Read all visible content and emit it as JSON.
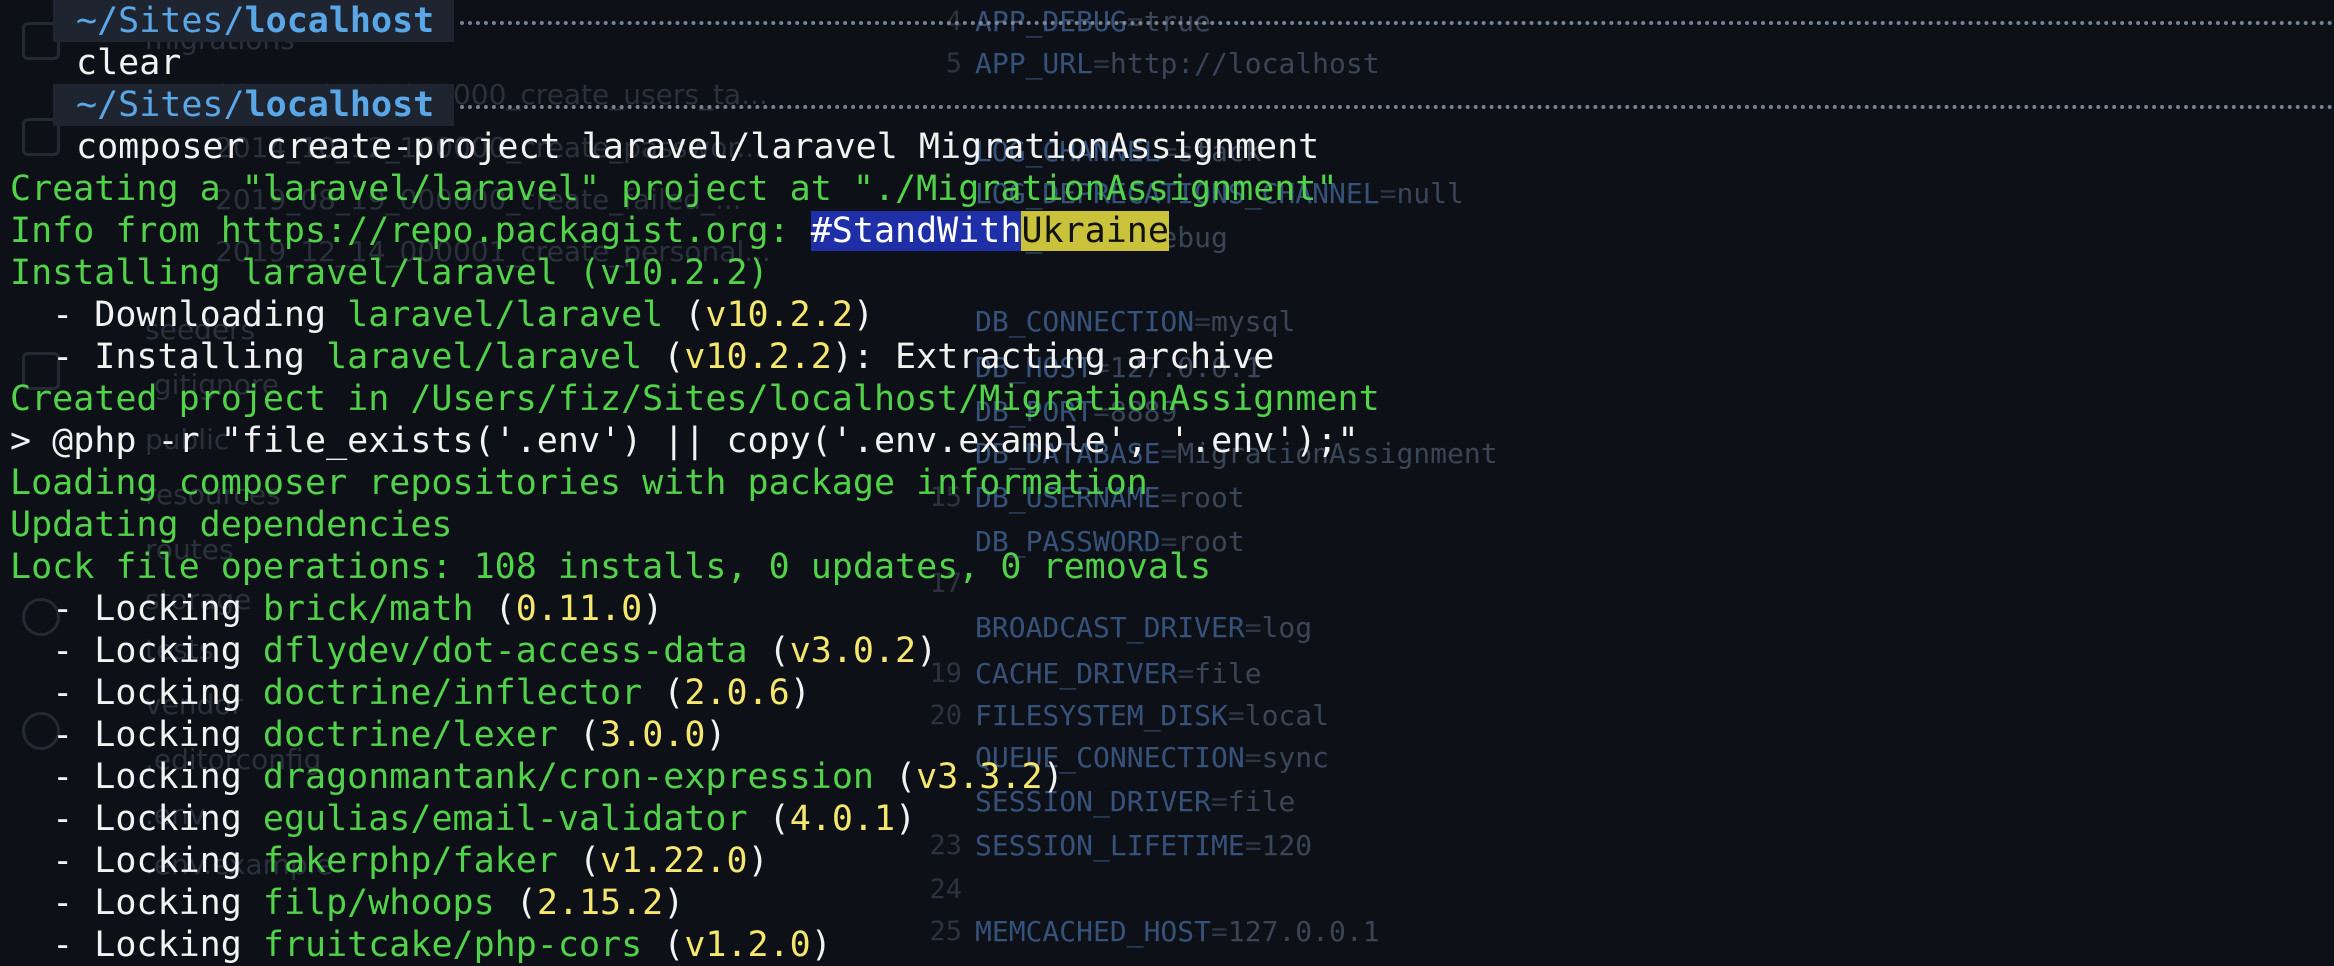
{
  "editor": {
    "lines": [
      {
        "n": "4",
        "key": "APP_DEBUG",
        "value": "true"
      },
      {
        "n": "5",
        "key": "APP_URL",
        "value": "http://localhost"
      },
      {
        "n": "",
        "key": "LOG_CHANNEL",
        "value": "stack"
      },
      {
        "n": "",
        "key": "LOG_DEPRECATIONS_CHANNEL",
        "value": "null"
      },
      {
        "n": "",
        "key": "LOG_LEVEL",
        "value": "debug"
      },
      {
        "n": "",
        "key": "DB_CONNECTION",
        "value": "mysql"
      },
      {
        "n": "",
        "key": "DB_HOST",
        "value": "127.0.0.1"
      },
      {
        "n": "",
        "key": "DB_PORT",
        "value": "8889"
      },
      {
        "n": "",
        "key": "DB_DATABASE",
        "value": "MigrationAssignment"
      },
      {
        "n": "15",
        "key": "DB_USERNAME",
        "value": "root"
      },
      {
        "n": "",
        "key": "DB_PASSWORD",
        "value": "root"
      },
      {
        "n": "17",
        "key": "",
        "value": ""
      },
      {
        "n": "",
        "key": "BROADCAST_DRIVER",
        "value": "log"
      },
      {
        "n": "19",
        "key": "CACHE_DRIVER",
        "value": "file"
      },
      {
        "n": "20",
        "key": "FILESYSTEM_DISK",
        "value": "local"
      },
      {
        "n": "",
        "key": "QUEUE_CONNECTION",
        "value": "sync"
      },
      {
        "n": "",
        "key": "SESSION_DRIVER",
        "value": "file"
      },
      {
        "n": "23",
        "key": "SESSION_LIFETIME",
        "value": "120"
      },
      {
        "n": "24",
        "key": "",
        "value": ""
      },
      {
        "n": "25",
        "key": "MEMCACHED_HOST",
        "value": "127.0.0.1"
      }
    ],
    "sidebar": [
      "migrations",
      "2014_10_12_000000_create_users_ta...",
      "2014_10_12_100000_create_passwor...",
      "2019_08_19_000000_create_failed_...",
      "2019_12_14_000001_create_personal...",
      "seeders",
      ".gitignore",
      "public",
      "resources",
      "routes",
      "storage",
      "tests",
      "vendor",
      ".editorconfig",
      ".env",
      ".env.example"
    ]
  },
  "terminal": {
    "prompt1": {
      "prefix": "~/Sites/",
      "dir": "localhost",
      "command": "clear"
    },
    "prompt2": {
      "prefix": "~/Sites/",
      "dir": "localhost",
      "command": "composer create-project laravel/laravel MigrationAssignment"
    },
    "creating": "Creating a \"laravel/laravel\" project at \"./MigrationAssignment\"",
    "info_prefix": "Info from https://repo.packagist.org: ",
    "info_tag_a": "#StandWith",
    "info_tag_b": "Ukraine",
    "installing": "Installing laravel/laravel (v10.2.2)",
    "downloading": {
      "lead": "  - Downloading ",
      "pkg": "laravel/laravel",
      "ver": "v10.2.2",
      "tail": ""
    },
    "installing2": {
      "lead": "  - Installing ",
      "pkg": "laravel/laravel",
      "ver": "v10.2.2",
      "tail": ": Extracting archive"
    },
    "created": "Created project in /Users/fiz/Sites/localhost/MigrationAssignment",
    "script": "> @php -r \"file_exists('.env') || copy('.env.example', '.env');\"",
    "loading": "Loading composer repositories with package information",
    "updating": "Updating dependencies",
    "lockfile": "Lock file operations: 108 installs, 0 updates, 0 removals",
    "locks": [
      {
        "pkg": "brick/math",
        "ver": "0.11.0"
      },
      {
        "pkg": "dflydev/dot-access-data",
        "ver": "v3.0.2"
      },
      {
        "pkg": "doctrine/inflector",
        "ver": "2.0.6"
      },
      {
        "pkg": "doctrine/lexer",
        "ver": "3.0.0"
      },
      {
        "pkg": "dragonmantank/cron-expression",
        "ver": "v3.3.2"
      },
      {
        "pkg": "egulias/email-validator",
        "ver": "4.0.1"
      },
      {
        "pkg": "fakerphp/faker",
        "ver": "v1.22.0"
      },
      {
        "pkg": "filp/whoops",
        "ver": "2.15.2"
      },
      {
        "pkg": "fruitcake/php-cors",
        "ver": "v1.2.0"
      }
    ],
    "lock_lead": "  - Locking "
  }
}
